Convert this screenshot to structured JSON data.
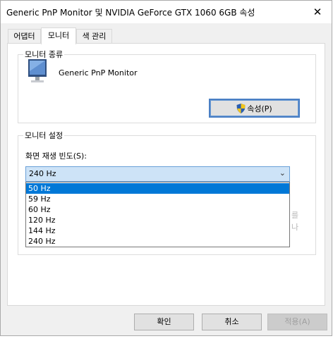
{
  "window": {
    "title": "Generic PnP Monitor 및 NVIDIA GeForce GTX 1060 6GB 속성",
    "close_glyph": "✕"
  },
  "tabs": [
    {
      "label": "어댑터",
      "active": false
    },
    {
      "label": "모니터",
      "active": true
    },
    {
      "label": "색 관리",
      "active": false
    }
  ],
  "monitor_type": {
    "group_label": "모니터 종류",
    "monitor_name": "Generic PnP Monitor",
    "properties_button": "속성(P)"
  },
  "monitor_settings": {
    "group_label": "모니터 설정",
    "refresh_rate_label": "화면 재생 빈도(S):",
    "selected_value": "240 Hz",
    "options": [
      "50 Hz",
      "59 Hz",
      "60 Hz",
      "120 Hz",
      "144 Hz",
      "240 Hz"
    ],
    "highlighted_option": "50 Hz"
  },
  "buttons": {
    "ok": "확인",
    "cancel": "취소",
    "apply": "적용(A)"
  },
  "colors": {
    "highlight": "#0078d7",
    "select_bg": "#cde3f7",
    "uac_blue": "#2a5fb0",
    "uac_yellow": "#f2c51a"
  }
}
